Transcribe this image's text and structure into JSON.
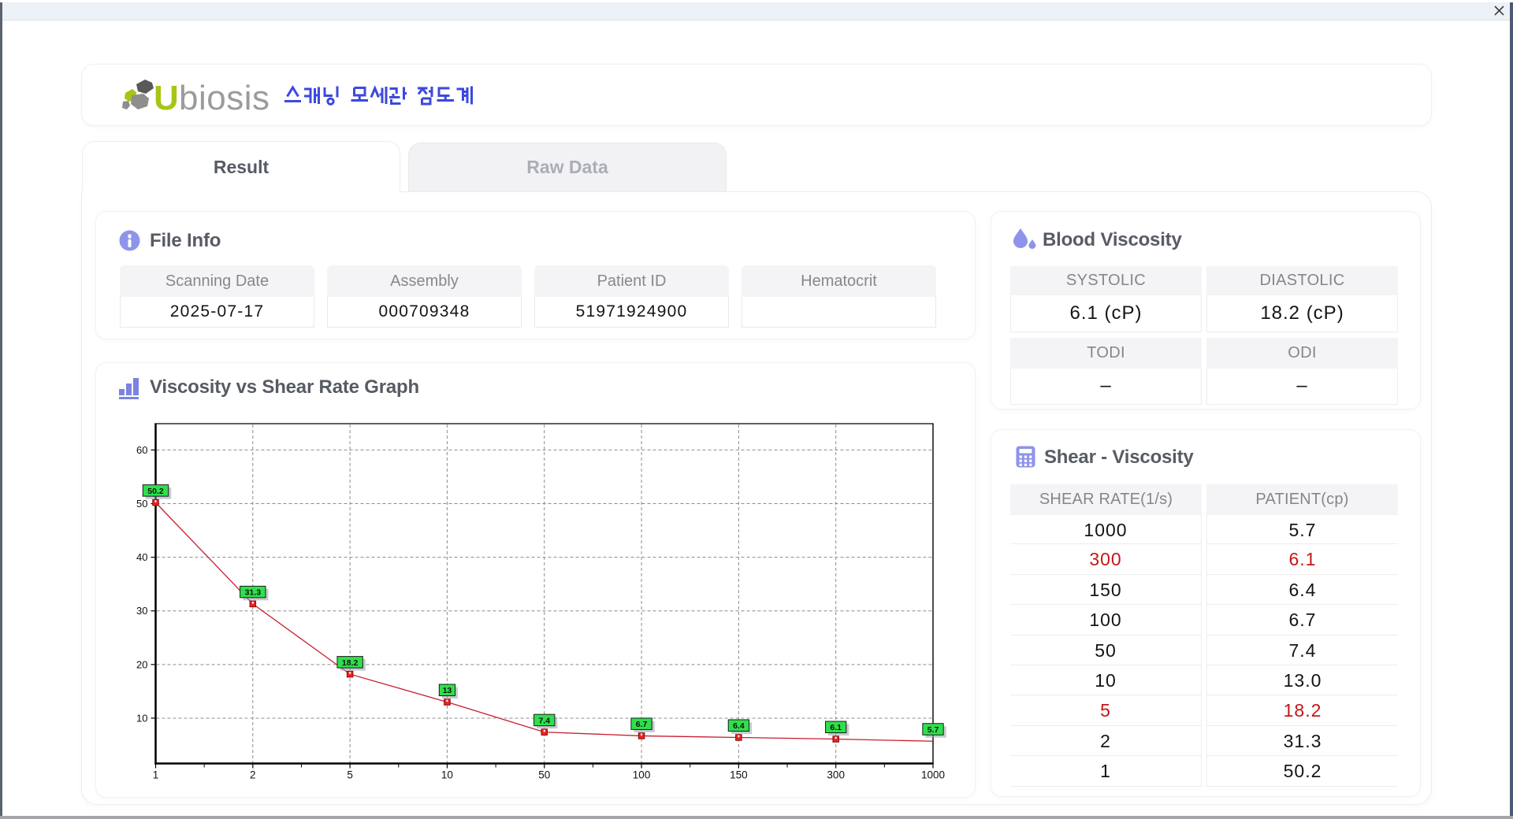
{
  "window": {
    "close_icon": "x"
  },
  "header": {
    "logo_text_u": "U",
    "logo_text_rest": "biosis",
    "app_title_korean": "스캐닝 모세관 점도계"
  },
  "tabs": {
    "result": "Result",
    "raw_data": "Raw Data"
  },
  "file_info": {
    "title": "File Info",
    "fields": [
      {
        "label": "Scanning Date",
        "value": "2025-07-17"
      },
      {
        "label": "Assembly",
        "value": "000709348"
      },
      {
        "label": "Patient ID",
        "value": "51971924900"
      },
      {
        "label": "Hematocrit",
        "value": ""
      }
    ]
  },
  "blood_viscosity": {
    "title": "Blood Viscosity",
    "sections": [
      {
        "headers": [
          "SYSTOLIC",
          "DIASTOLIC"
        ],
        "values": [
          "6.1 (cP)",
          "18.2 (cP)"
        ]
      },
      {
        "headers": [
          "TODI",
          "ODI"
        ],
        "values": [
          "–",
          "–"
        ]
      }
    ]
  },
  "shear_viscosity": {
    "title": "Shear - Viscosity",
    "columns": [
      "SHEAR RATE(1/s)",
      "PATIENT(cp)"
    ],
    "rows": [
      {
        "shear_rate": "1000",
        "patient": "5.7",
        "highlight": false
      },
      {
        "shear_rate": "300",
        "patient": "6.1",
        "highlight": true
      },
      {
        "shear_rate": "150",
        "patient": "6.4",
        "highlight": false
      },
      {
        "shear_rate": "100",
        "patient": "6.7",
        "highlight": false
      },
      {
        "shear_rate": "50",
        "patient": "7.4",
        "highlight": false
      },
      {
        "shear_rate": "10",
        "patient": "13.0",
        "highlight": false
      },
      {
        "shear_rate": "5",
        "patient": "18.2",
        "highlight": true
      },
      {
        "shear_rate": "2",
        "patient": "31.3",
        "highlight": false
      },
      {
        "shear_rate": "1",
        "patient": "50.2",
        "highlight": false
      }
    ],
    "highlight_color": "#c41616"
  },
  "chart_data": {
    "type": "line",
    "title": "Viscosity vs Shear Rate Graph",
    "x_scale": "categorical",
    "categories": [
      "1",
      "2",
      "5",
      "10",
      "50",
      "100",
      "150",
      "300",
      "1000"
    ],
    "series": [
      {
        "name": "PATIENT",
        "values": [
          50.2,
          31.3,
          18.2,
          13,
          7.4,
          6.7,
          6.4,
          6.1,
          5.7
        ],
        "point_labels": [
          "50.2",
          "31.3",
          "18.2",
          "13",
          "7.4",
          "6.7",
          "6.4",
          "6.1",
          "5.7"
        ]
      }
    ],
    "xlabel": "",
    "ylabel": "",
    "yticks": [
      10,
      20,
      30,
      40,
      50,
      60
    ],
    "ylim": [
      1.55,
      64.9
    ],
    "grid": true,
    "legend": false,
    "colors": {
      "line": "#c51f30",
      "marker_fill": "#ee2222",
      "marker_border": "#7d0f0f",
      "label_bg": "#2ee04b",
      "label_border": "#1a1a1a",
      "grid_line": "#8c8c8c",
      "axis": "#000000"
    }
  }
}
